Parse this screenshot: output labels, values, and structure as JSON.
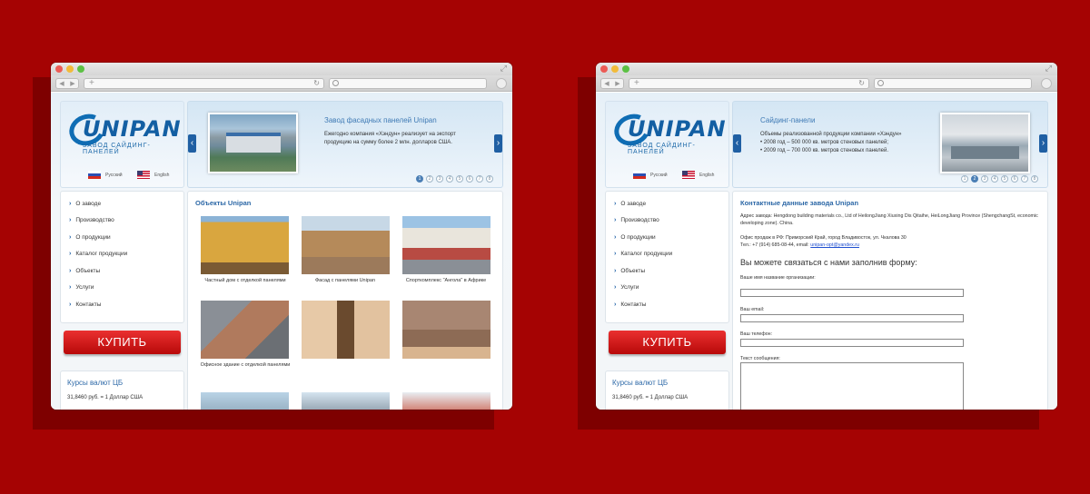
{
  "left_window": {
    "lang_ru": "Русский",
    "lang_en": "English",
    "slider": {
      "title": "Завод фасадных панелей Unipan",
      "text": "Ежегодно компания «Хэндун» реализует на экспорт продукцию на сумму более 2 млн. долларов США.",
      "pages": [
        "1",
        "2",
        "3",
        "4",
        "5",
        "6",
        "7",
        "8"
      ],
      "active_page": "1"
    },
    "menu": [
      "О заводе",
      "Производство",
      "О продукции",
      "Каталог продукции",
      "Объекты",
      "Услуги",
      "Контакты"
    ],
    "buy_label": "КУПИТЬ",
    "rates": {
      "title": "Курсы валют ЦБ",
      "line": "31,8460 руб. = 1 Доллар США"
    },
    "content": {
      "title": "Объекты Unipan",
      "photos": [
        {
          "caption": "Частный дом с отделкой панелями"
        },
        {
          "caption": "Фасад с панелями Unipan"
        },
        {
          "caption": "Спорткомплекс \"Ангола\" в Африке"
        },
        {
          "caption": "Офисное здание с отделкой панелями"
        },
        {
          "caption": ""
        },
        {
          "caption": ""
        }
      ]
    }
  },
  "right_window": {
    "lang_ru": "Русский",
    "lang_en": "English",
    "slider": {
      "title": "Сайдинг-панели",
      "text_intro": "Объемы реализованной продукции компании «Хэндун»",
      "text_line1": "• 2008 год – 500 000 кв. метров стеновых панелей;",
      "text_line2": "• 2009 год – 700 000 кв. метров стеновых панелей.",
      "pages": [
        "1",
        "2",
        "3",
        "4",
        "5",
        "6",
        "7",
        "8"
      ],
      "active_page": "2"
    },
    "menu": [
      "О заводе",
      "Производство",
      "О продукции",
      "Каталог продукции",
      "Объекты",
      "Услуги",
      "Контакты"
    ],
    "buy_label": "КУПИТЬ",
    "rates": {
      "title": "Курсы валют ЦБ",
      "line": "31,8460 руб. = 1 Доллар США"
    },
    "content": {
      "title": "Контактные данные завода Unipan",
      "address": "Адрес завода: Hengdong building materials co., Ltd of HeilongJiang Xiuxing Dis Qitaihe, HeiLongJiang Province (ShengchangSt, economic developing zone). China.",
      "office": "Офис продаж в РФ: Приморский Край, город Владивосток, ул. Чкалова 30",
      "phone_email": "Тел.: +7 (914) 685-08-44, email:",
      "email": "unipan-opt@yandex.ru",
      "form_heading": "Вы можете связаться с нами заполнив форму:",
      "label_name": "Ваше имя название организации:",
      "label_email": "Ваш email:",
      "label_phone": "Ваш телефон:",
      "label_message": "Текст сообщения:"
    }
  },
  "colors": {
    "background": "#a50303",
    "accent_blue": "#1f5fa3",
    "buy_button": "#d81e1e"
  }
}
